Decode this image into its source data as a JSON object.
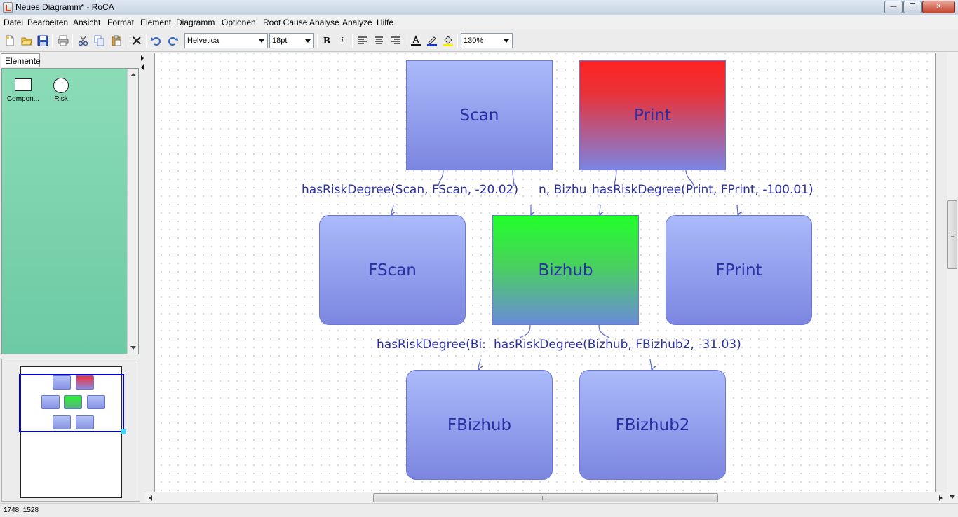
{
  "window": {
    "title": "Neues Diagramm* - RoCA"
  },
  "menu": [
    "Datei",
    "Bearbeiten",
    "Ansicht",
    "Format",
    "Element",
    "Diagramm",
    "Optionen",
    "Root Cause Analyse",
    "Analyze",
    "Hilfe"
  ],
  "toolbar": {
    "font_family": "Helvetica",
    "font_size": "18pt",
    "zoom": "130%",
    "bold_label": "B",
    "italic_label": "i"
  },
  "left_panel": {
    "tab_label": "Elemente",
    "palette": [
      {
        "label": "Compon...",
        "shape": "rectangle"
      },
      {
        "label": "Risk",
        "shape": "circle"
      }
    ]
  },
  "diagram": {
    "nodes": {
      "scan": "Scan",
      "print": "Print",
      "fscan": "FScan",
      "bizhub": "Bizhub",
      "fprint": "FPrint",
      "fbizhub": "FBizhub",
      "fbizhub2": "FBizhub2"
    },
    "edge_labels": {
      "scan_fscan": "hasRiskDegree(Scan, FScan, -20.02)",
      "scan_bizhub_tail": "n, Bizhu",
      "print_fprint": "hasRiskDegree(Print, FPrint, -100.01)",
      "bizhub_fbizhub_head": "hasRiskDegree(Bi:",
      "bizhub_fbizhub2": "hasRiskDegree(Bizhub, FBizhub2, -31.03)"
    }
  },
  "colors": {
    "node_text": "#2a2fa3",
    "node_blue_top": "#aabafa",
    "node_blue_bottom": "#7c86e0",
    "risk_red": "#ff2323",
    "risk_green": "#22ff2a",
    "palette_green": "#8bdcb6"
  },
  "status": {
    "coords": "1748, 1528"
  }
}
